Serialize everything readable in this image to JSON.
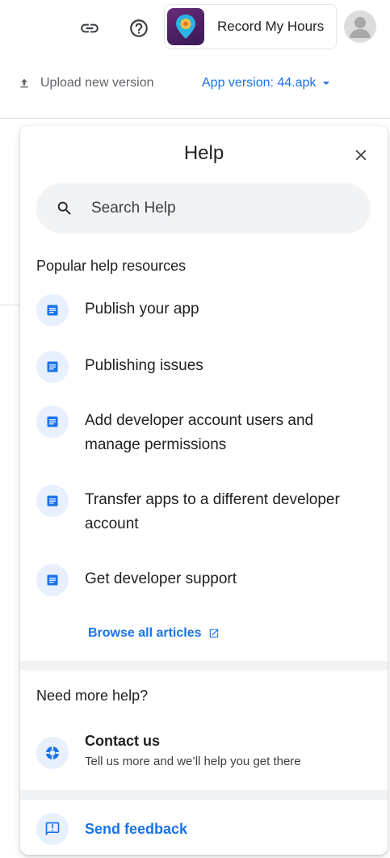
{
  "topbar": {
    "app_name": "Record My Hours"
  },
  "subbar": {
    "upload_label": "Upload new version",
    "version_label": "App version: 44.apk"
  },
  "help_panel": {
    "title": "Help",
    "search_placeholder": "Search Help",
    "popular_title": "Popular help resources",
    "resources": [
      {
        "label": "Publish your app",
        "icon": "article-icon"
      },
      {
        "label": "Publishing issues",
        "icon": "article-icon"
      },
      {
        "label": "Add developer account users and manage permissions",
        "icon": "article-icon"
      },
      {
        "label": "Transfer apps to a different developer account",
        "icon": "article-icon"
      },
      {
        "label": "Get developer support",
        "icon": "article-icon"
      }
    ],
    "browse_label": "Browse all articles",
    "need_more_title": "Need more help?",
    "contact": {
      "title": "Contact us",
      "subtitle": "Tell us more and we’ll help you get there"
    },
    "feedback_label": "Send feedback"
  },
  "colors": {
    "accent": "#1a73e8",
    "icon_bg": "#e8f0fe",
    "search_bg": "#f1f3f4",
    "text": "#202124",
    "muted": "#5f6368"
  }
}
